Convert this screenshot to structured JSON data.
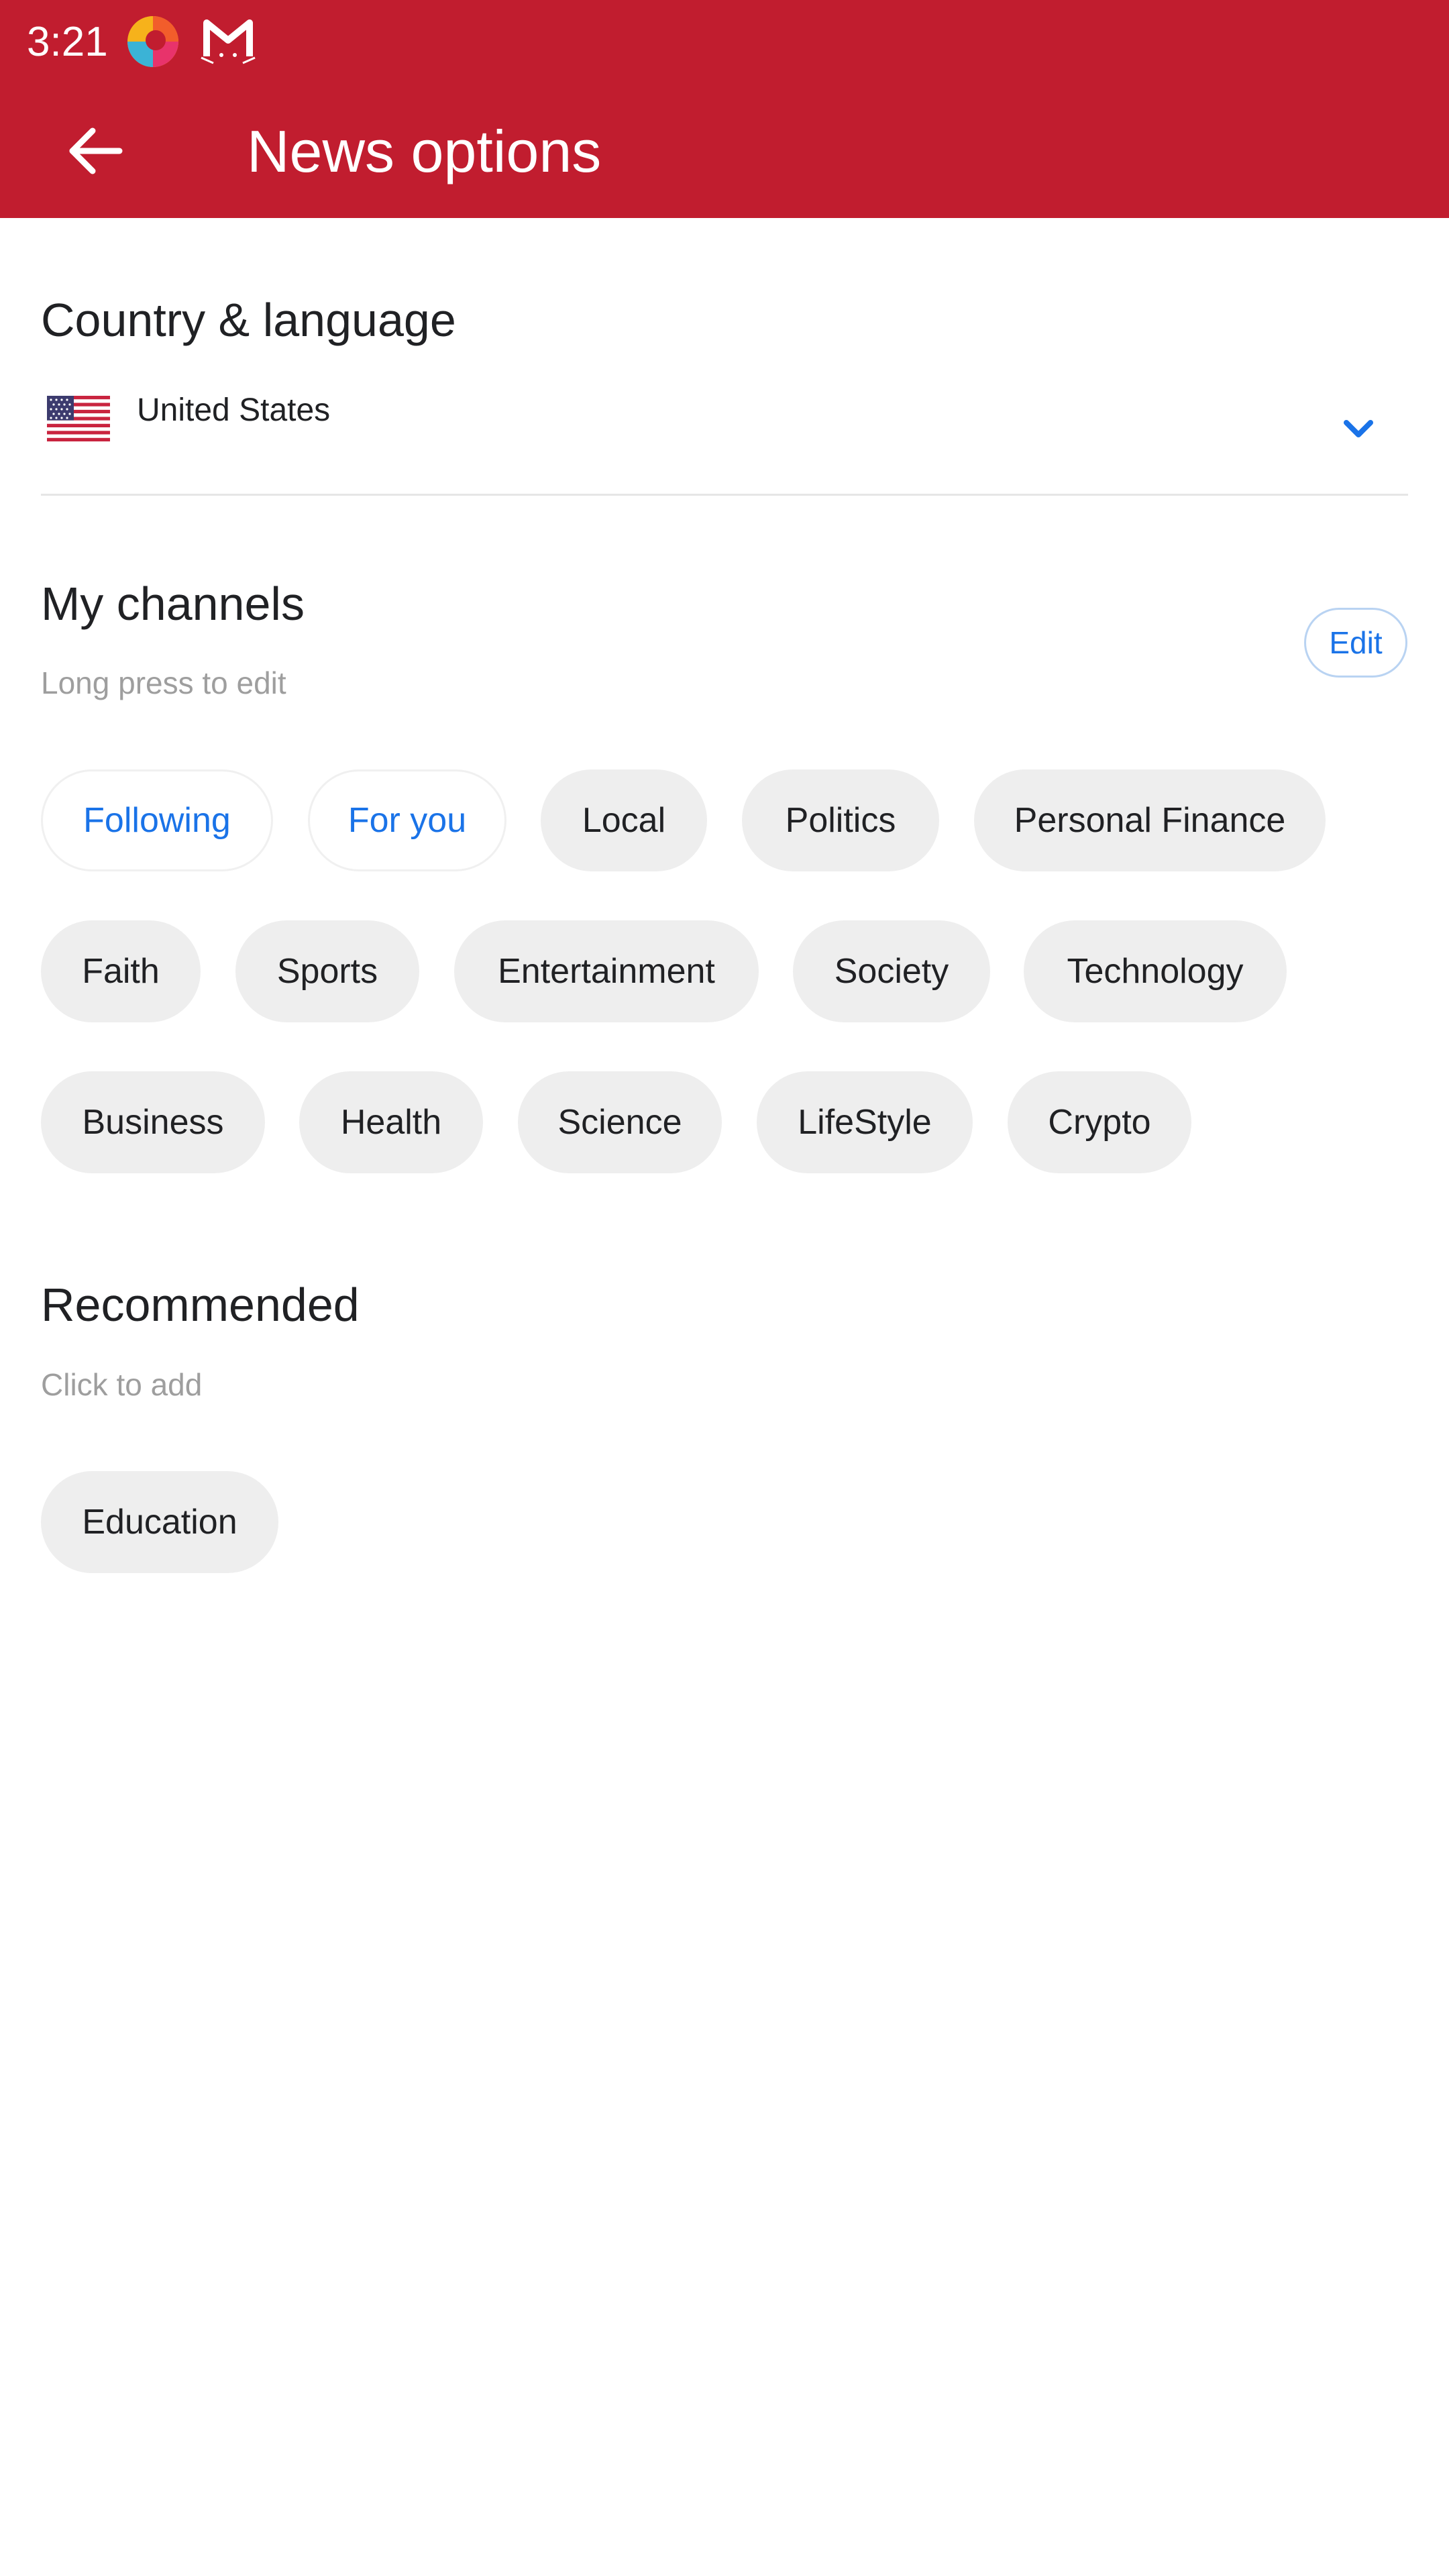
{
  "status_bar": {
    "time": "3:21",
    "icons": [
      "browser-app-icon",
      "mail-app-icon"
    ]
  },
  "app_bar": {
    "back_icon": "arrow-back-icon",
    "title": "News options",
    "background_color": "#c11d2f"
  },
  "country_language": {
    "title": "Country & language",
    "flag_icon": "us-flag-icon",
    "selected_country": "United States",
    "dropdown_icon": "chevron-down-icon"
  },
  "my_channels": {
    "title": "My channels",
    "hint": "Long press to edit",
    "edit_label": "Edit",
    "fixed_channels": [
      "Following",
      "For you"
    ],
    "channels": [
      "Local",
      "Politics",
      "Personal Finance",
      "Faith",
      "Sports",
      "Entertainment",
      "Society",
      "Technology",
      "Business",
      "Health",
      "Science",
      "LifeStyle",
      "Crypto"
    ]
  },
  "recommended": {
    "title": "Recommended",
    "hint": "Click to add",
    "channels": [
      "Education"
    ]
  },
  "colors": {
    "accent": "#1a73e8",
    "chip_background": "#eeeeee",
    "hint_text": "#9e9e9e"
  }
}
